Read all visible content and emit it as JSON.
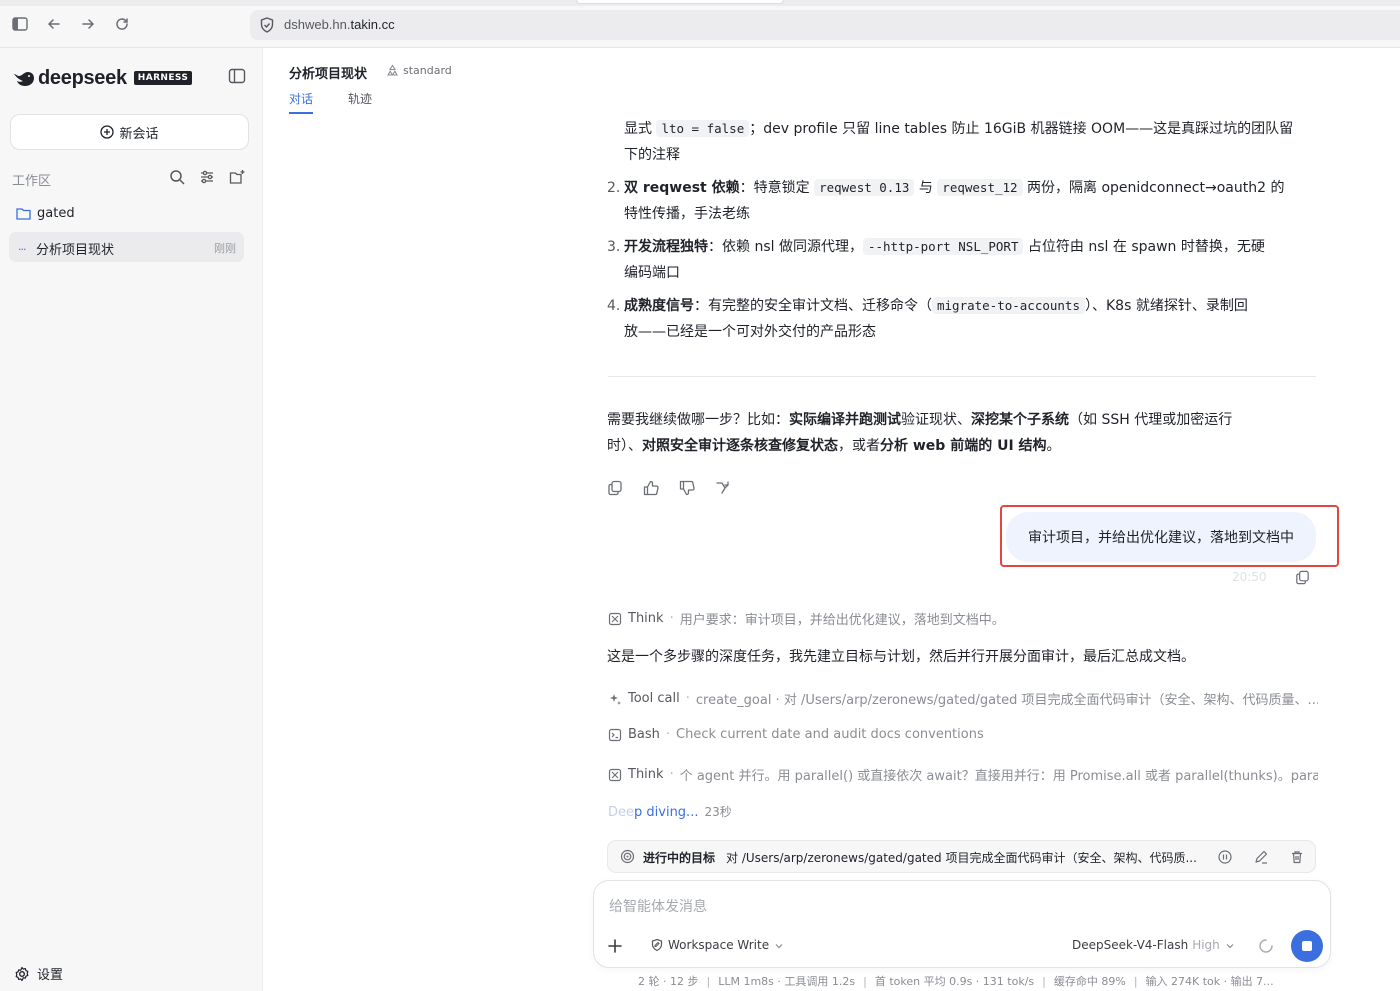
{
  "browser": {
    "url_prefix": "dshweb.hn.",
    "url_domain": "takin.cc"
  },
  "sidebar": {
    "logo_text": "deepseek",
    "logo_badge": "HARNESS",
    "new_chat_label": "新会话",
    "workspace_label": "工作区",
    "folder_name": "gated",
    "session": {
      "dots": "...",
      "name": "分析项目现状",
      "time": "刚刚"
    },
    "settings_label": "设置"
  },
  "header": {
    "title": "分析项目现状",
    "mode": "standard",
    "tabs": [
      {
        "label": "对话"
      },
      {
        "label": "轨迹"
      }
    ]
  },
  "assistant_prev": {
    "line0_a": "显式 ",
    "line0_code": "lto = false",
    "line0_b": "；dev profile 只留 line tables 防止 16GiB 机器链接 OOM——这是真踩过坑的团队留",
    "line0_c": "下的注释",
    "items": [
      {
        "num": "2.",
        "bold": "双 reqwest 依赖",
        "t1": "：特意锁定 ",
        "c1": "reqwest 0.13",
        "t2": " 与 ",
        "c2": "reqwest_12",
        "t3": " 两份，隔离 openidconnect→oauth2 的",
        "t4": "特性传播，手法老练"
      },
      {
        "num": "3.",
        "bold": "开发流程独特",
        "t1": "：依赖 nsl 做同源代理，",
        "c1": "--http-port NSL_PORT",
        "t2": " 占位符由 nsl 在 spawn 时替换，无硬",
        "t3": "编码端口"
      },
      {
        "num": "4.",
        "bold": "成熟度信号",
        "t1": "：有完整的安全审计文档、迁移命令（",
        "c1": "migrate-to-accounts",
        "t2": "）、K8s 就绪探针、录制回",
        "t3": "放——已经是一个可对外交付的产品形态"
      }
    ],
    "followup_a": "需要我继续做哪一步？比如：",
    "followup_b1": "实际编译并跑测试",
    "followup_c": "验证现状、",
    "followup_b2": "深挖某个子系统",
    "followup_d": "（如 SSH 代理或加密运行",
    "followup_e": "时）、",
    "followup_b3": "对照安全审计逐条核查修复状态",
    "followup_f": "，或者",
    "followup_b4": "分析 web 前端的 UI 结构",
    "followup_g": "。"
  },
  "user_message": {
    "text": "审计项目，并给出优化建议，落地到文档中",
    "time": "20:50"
  },
  "steps": [
    {
      "kind": "Think",
      "detail": "用户要求：审计项目，并给出优化建议，落地到文档中。",
      "icon": "brain-icon"
    },
    {
      "kind": "Tool call",
      "detail": "create_goal · 对 /Users/arp/zeronews/gated/gated 项目完成全面代码审计（安全、架构、代码质量、...",
      "icon": "sparkle-icon"
    },
    {
      "kind": "Bash",
      "detail": "Check current date and audit docs conventions",
      "icon": "terminal-icon"
    },
    {
      "kind": "Think",
      "detail": "个 agent 并行。用 parallel() 或直接依次 await？直接用并行：用 Promise.all 或者 parallel(thunks)。parallel",
      "icon": "brain-icon"
    }
  ],
  "assistant_text": "这是一个多步骤的深度任务，我先建立目标与计划，然后并行开展分面审计，最后汇总成文档。",
  "deep": {
    "part1": "Dee",
    "part2": "p diving...",
    "time": "23秒"
  },
  "goal": {
    "label": "进行中的目标",
    "text": "对 /Users/arp/zeronews/gated/gated 项目完成全面代码审计（安全、架构、代码质..."
  },
  "composer": {
    "placeholder": "给智能体发消息",
    "workspace_mode": "Workspace Write",
    "model": "DeepSeek-V4-Flash",
    "level": "High"
  },
  "status": [
    "2 轮 · 12 步",
    "LLM 1m8s · 工具调用 1.2s",
    "首 token 平均 0.9s · 131 tok/s",
    "缓存命中 89%",
    "输入 274K tok · 输出 7..."
  ],
  "colors": {
    "accent": "#3b6fe0",
    "highlight": "#e0473e",
    "bubble": "#eef3fe"
  }
}
